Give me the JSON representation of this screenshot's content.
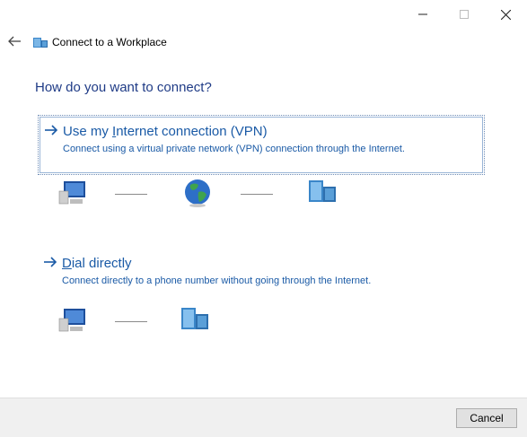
{
  "window": {
    "title": "Connect to a Workplace",
    "controls": [
      "minimize-icon",
      "maximize-icon",
      "close-icon"
    ]
  },
  "main": {
    "heading": "How do you want to connect?",
    "options": [
      {
        "title_before": "Use my ",
        "title_underlined": "I",
        "title_after": "nternet connection (VPN)",
        "description": "Connect using a virtual private network (VPN) connection through the Internet.",
        "diagram_icons": [
          "computer-icon",
          "globe-icon",
          "workplace-server-icon"
        ]
      },
      {
        "title_before": "",
        "title_underlined": "D",
        "title_after": "ial directly",
        "description": "Connect directly to a phone number without going through the Internet.",
        "diagram_icons": [
          "computer-icon",
          "workplace-server-icon"
        ]
      }
    ]
  },
  "footer": {
    "cancel_label": "Cancel"
  },
  "colors": {
    "heading": "#1f3b86",
    "link": "#1a5aa6",
    "footer_bg": "#f0f0f0"
  }
}
